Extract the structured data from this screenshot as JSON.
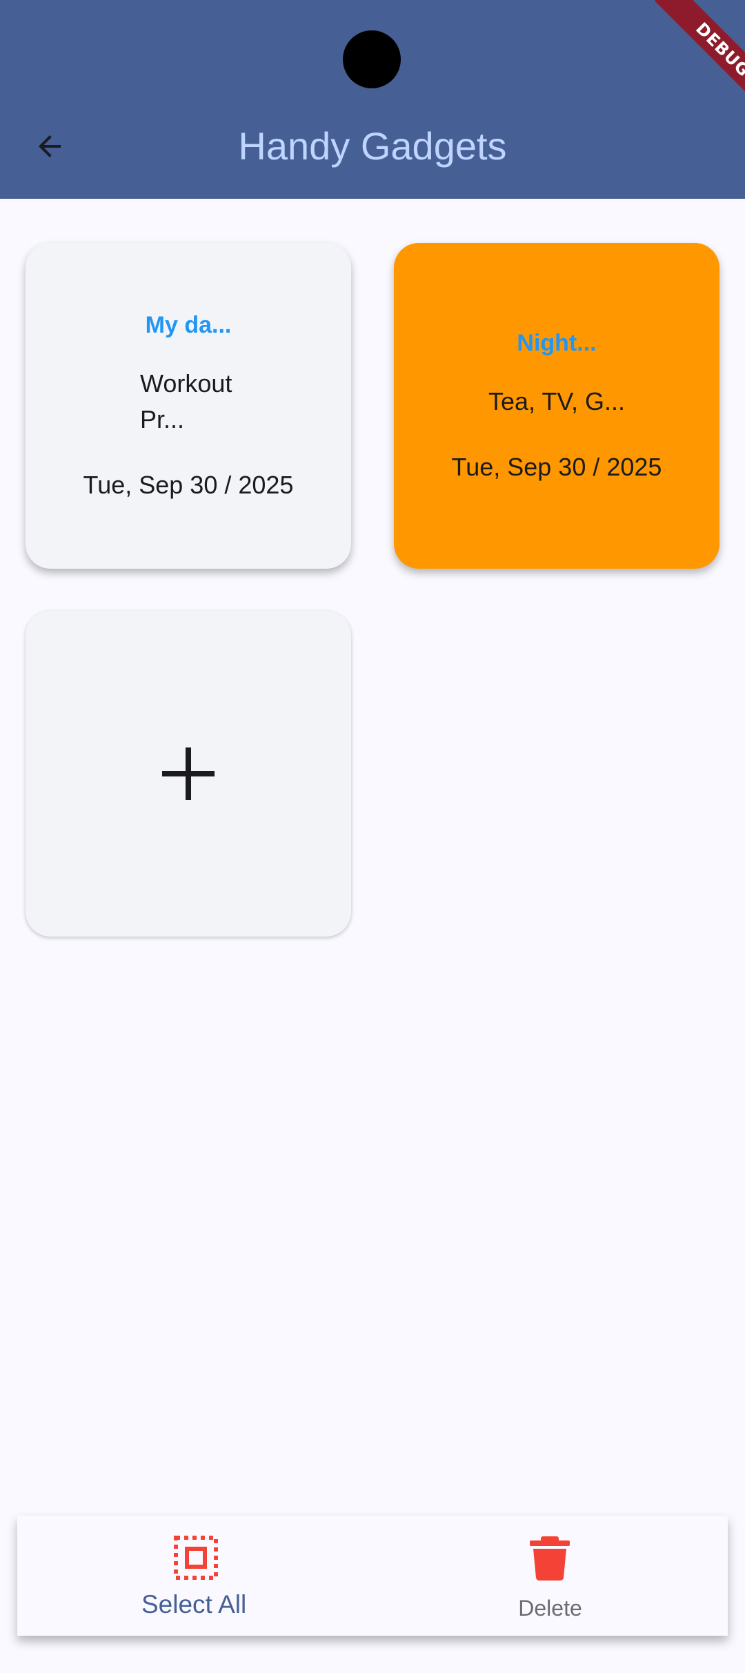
{
  "app_bar": {
    "title": "Handy Gadgets",
    "back_icon": "arrow-left-icon",
    "background": "#465F95",
    "title_color": "#BFD4FF"
  },
  "debug_banner": {
    "label": "DEBUG"
  },
  "cards": [
    {
      "title": "My da...",
      "body_line1": "Workout",
      "body_line2": "Pr...",
      "date": "Tue, Sep 30 / 2025",
      "background": "#F3F4F8"
    },
    {
      "title": "Night...",
      "body": "Tea, TV, G...",
      "date": "Tue, Sep 30 / 2025",
      "background": "#FF9800"
    }
  ],
  "add_card": {
    "icon": "plus-icon"
  },
  "bottom_bar": {
    "select_all": {
      "label": "Select All",
      "icon": "select-all-icon",
      "color": "#F44336"
    },
    "delete": {
      "label": "Delete",
      "icon": "trash-icon",
      "color": "#F44336"
    }
  }
}
